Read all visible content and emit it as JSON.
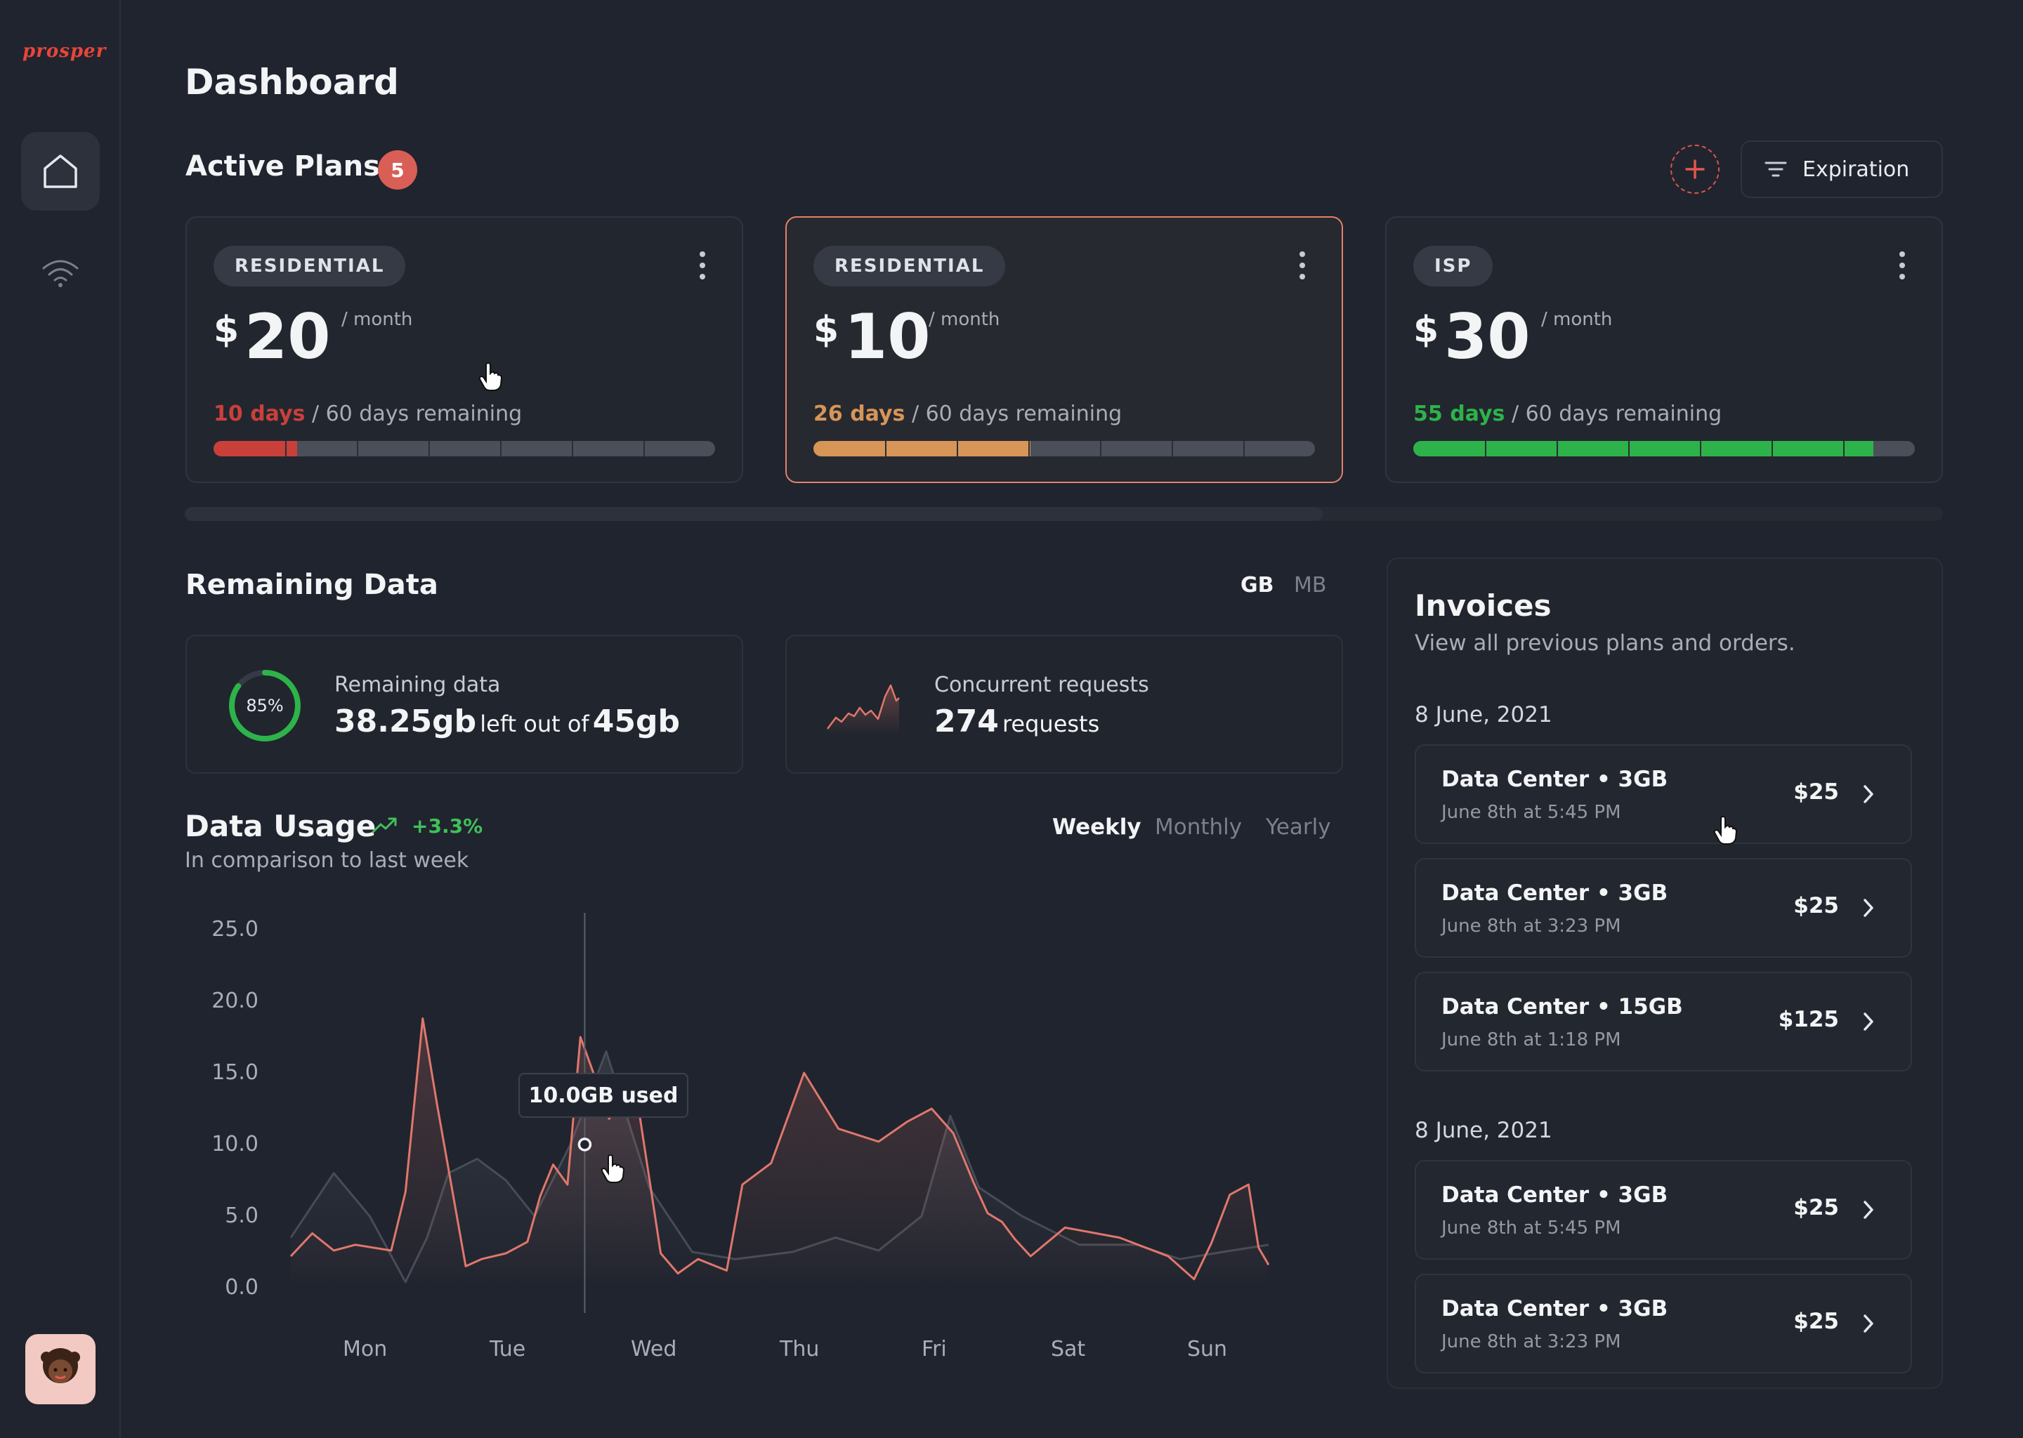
{
  "brand": {
    "logo_text": "prosper"
  },
  "page": {
    "title": "Dashboard"
  },
  "nav": {
    "items": [
      {
        "icon": "home-icon",
        "active": true
      },
      {
        "icon": "wifi-icon",
        "active": false
      }
    ]
  },
  "active_plans": {
    "title": "Active Plans",
    "count": "5",
    "filter_label": "Expiration",
    "plans": [
      {
        "tag": "RESIDENTIAL",
        "currency": "$",
        "price": "20",
        "per": "/ month",
        "days": "10 days",
        "total": "/ 60 days remaining",
        "progress": 0.1667,
        "color": "#c9403b",
        "selected": false
      },
      {
        "tag": "RESIDENTIAL",
        "currency": "$",
        "price": "10",
        "per": "/ month",
        "days": "26 days",
        "total": "/ 60 days remaining",
        "progress": 0.4333,
        "color": "#d79558",
        "selected": true
      },
      {
        "tag": "ISP",
        "currency": "$",
        "price": "30",
        "per": "/ month",
        "days": "55 days",
        "total": "/ 60 days remaining",
        "progress": 0.9167,
        "color": "#2db34a",
        "selected": false
      }
    ]
  },
  "remaining_data": {
    "title": "Remaining Data",
    "units": {
      "gb": "GB",
      "mb": "MB",
      "selected": "GB"
    },
    "ring": {
      "percent_label": "85%",
      "percent": 0.85
    },
    "data_card": {
      "label": "Remaining data",
      "value": "38.25gb",
      "mid": "left out of",
      "total": "45gb"
    },
    "requests_card": {
      "label": "Concurrent requests",
      "value": "274",
      "unit": "requests"
    }
  },
  "data_usage": {
    "title": "Data Usage",
    "trend": "+3.3%",
    "subtitle": "In comparison to last week",
    "periods": {
      "weekly": "Weekly",
      "monthly": "Monthly",
      "yearly": "Yearly",
      "selected": "Weekly"
    },
    "tooltip": "10.0GB used"
  },
  "chart_data": {
    "type": "area",
    "title": "",
    "xlabel": "",
    "ylabel": "",
    "ylim": [
      0,
      25
    ],
    "yticks": [
      "25.0",
      "20.0",
      "15.0",
      "10.0",
      "5.0",
      "0.0"
    ],
    "categories": [
      "Mon",
      "Tue",
      "Wed",
      "Thu",
      "Fri",
      "Sat",
      "Sun"
    ],
    "series": [
      {
        "name": "",
        "color": "#e0776c",
        "x": [
          0,
          0.15,
          0.3,
          0.45,
          0.7,
          0.8,
          0.92,
          1.02,
          1.22,
          1.33,
          1.5,
          1.65,
          1.74,
          1.83,
          1.93,
          2.02,
          2.1,
          2.22,
          2.4,
          2.58,
          2.7,
          2.84,
          3.04,
          3.15,
          3.35,
          3.58,
          3.82,
          4.1,
          4.3,
          4.47,
          4.62,
          4.76,
          4.86,
          4.96,
          5.05,
          5.16,
          5.4,
          5.78,
          6.12,
          6.3,
          6.42,
          6.55,
          6.68,
          6.75,
          6.82
        ],
        "values": [
          2.2,
          3.8,
          2.6,
          3.0,
          2.6,
          6.7,
          18.8,
          12.8,
          1.5,
          2.0,
          2.4,
          3.2,
          6.4,
          8.6,
          7.2,
          17.5,
          15.3,
          11.8,
          14.2,
          2.4,
          1.0,
          2.0,
          1.2,
          7.2,
          8.7,
          15.0,
          11.1,
          10.2,
          11.6,
          12.5,
          10.8,
          7.4,
          5.2,
          4.6,
          3.4,
          2.2,
          4.2,
          3.5,
          2.2,
          0.6,
          3.1,
          6.5,
          7.2,
          2.8,
          1.6
        ]
      },
      {
        "name": "",
        "color": "#4a505c",
        "x": [
          0,
          0.3,
          0.55,
          0.8,
          0.95,
          1.1,
          1.3,
          1.5,
          1.7,
          1.95,
          2.2,
          2.5,
          2.8,
          3.1,
          3.5,
          3.8,
          4.1,
          4.4,
          4.6,
          4.8,
          5.1,
          5.5,
          5.9,
          6.2,
          6.5,
          6.82
        ],
        "values": [
          3.5,
          8.0,
          5.0,
          0.4,
          3.5,
          8.0,
          9.0,
          7.5,
          5.0,
          10.0,
          16.5,
          7.0,
          2.5,
          2.0,
          2.5,
          3.5,
          2.6,
          5.0,
          12.0,
          7.0,
          5.0,
          3.0,
          3.0,
          2.0,
          2.5,
          3.0
        ]
      }
    ],
    "marker": {
      "x": 2.05,
      "value": 10.0,
      "label": "10.0GB used"
    }
  },
  "invoices": {
    "title": "Invoices",
    "subtitle": "View all previous plans and orders.",
    "groups": [
      {
        "date": "8 June, 2021",
        "items": [
          {
            "name": "Data Center • 3GB",
            "when": "June 8th at 5:45 PM",
            "price": "$25"
          },
          {
            "name": "Data Center • 3GB",
            "when": "June 8th at 3:23 PM",
            "price": "$25"
          },
          {
            "name": "Data Center • 15GB",
            "when": "June 8th at 1:18 PM",
            "price": "$125"
          }
        ]
      },
      {
        "date": "8 June, 2021",
        "items": [
          {
            "name": "Data Center • 3GB",
            "when": "June 8th at 5:45 PM",
            "price": "$25"
          },
          {
            "name": "Data Center • 3GB",
            "when": "June 8th at 3:23 PM",
            "price": "$25"
          }
        ]
      }
    ]
  },
  "colors": {
    "background": "#20242e",
    "accent": "#e0776c",
    "danger": "#c9403b",
    "warning": "#d79558",
    "success": "#2db34a"
  }
}
